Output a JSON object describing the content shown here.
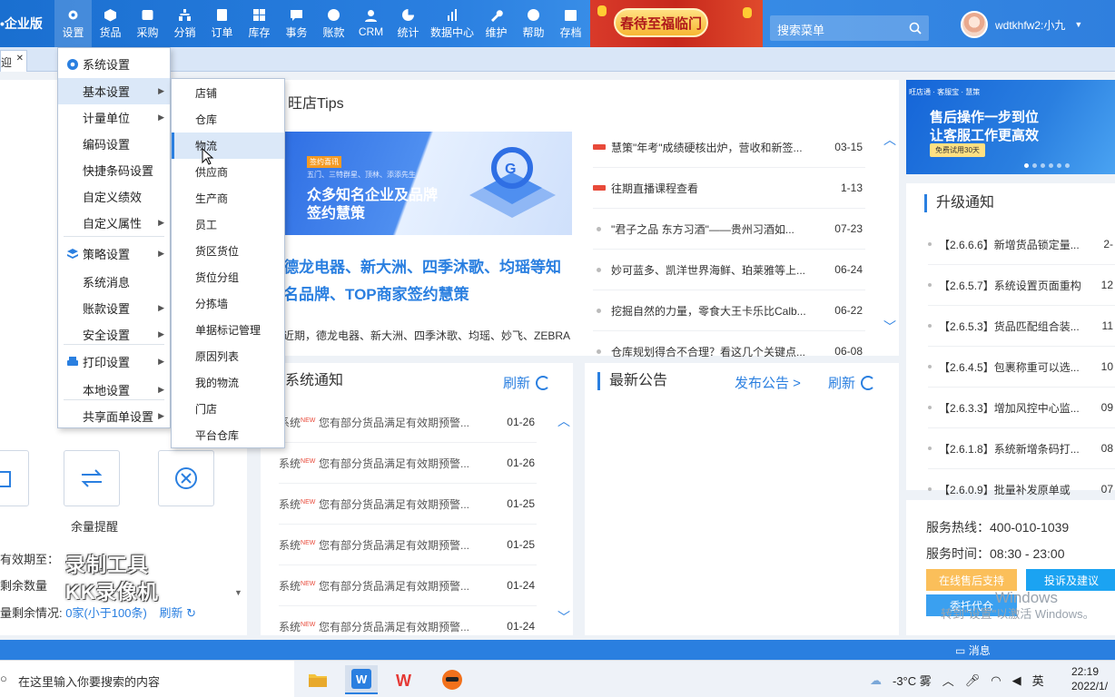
{
  "app": {
    "logo": "•企业版"
  },
  "nav": [
    {
      "label": "设置",
      "icon": "gear-icon"
    },
    {
      "label": "货品",
      "icon": "box-icon"
    },
    {
      "label": "采购",
      "icon": "cart-icon"
    },
    {
      "label": "分销",
      "icon": "distribution-icon"
    },
    {
      "label": "订单",
      "icon": "order-icon"
    },
    {
      "label": "库存",
      "icon": "grid-icon"
    },
    {
      "label": "事务",
      "icon": "chat-icon"
    },
    {
      "label": "账款",
      "icon": "yen-icon"
    },
    {
      "label": "CRM",
      "icon": "person-icon"
    },
    {
      "label": "统计",
      "icon": "pie-icon"
    },
    {
      "label": "数据中心",
      "icon": "bar-chart-icon"
    },
    {
      "label": "维护",
      "icon": "wrench-icon"
    },
    {
      "label": "帮助",
      "icon": "help-icon"
    },
    {
      "label": "存档",
      "icon": "archive-icon"
    }
  ],
  "festive_banner": "春待至福临门",
  "search": {
    "placeholder": "搜索菜单"
  },
  "user": {
    "name": "wdtkhfw2:小九"
  },
  "tab": {
    "label": "迎"
  },
  "settings_menu": [
    {
      "label": "系统设置",
      "group": true
    },
    {
      "label": "基本设置",
      "sub": true
    },
    {
      "label": "计量单位",
      "sub": true
    },
    {
      "label": "编码设置",
      "sub": false
    },
    {
      "label": "快捷条码设置",
      "sub": false
    },
    {
      "label": "自定义绩效",
      "sub": false
    },
    {
      "label": "自定义属性",
      "sub": true
    },
    {
      "label": "策略设置",
      "group": true,
      "sub": true
    },
    {
      "label": "系统消息",
      "sub": false
    },
    {
      "label": "账款设置",
      "sub": true
    },
    {
      "label": "安全设置",
      "sub": true
    },
    {
      "label": "打印设置",
      "group": true,
      "sub": true
    },
    {
      "label": "本地设置",
      "sub": true
    },
    {
      "label": "共享面单设置",
      "sub": true
    }
  ],
  "basic_submenu": [
    "店铺",
    "仓库",
    "物流",
    "供应商",
    "生产商",
    "员工",
    "货区货位",
    "货位分组",
    "分拣墙",
    "单据标记管理",
    "原因列表",
    "我的物流",
    "门店",
    "平台仓库"
  ],
  "tips": {
    "title": "旺店Tips",
    "banner": {
      "tag": "签约喜讯",
      "sub": "五门、三特群星、顶林、添添先生",
      "line1": "众多知名企业及品牌",
      "line2": "签约慧策"
    },
    "headline": "德龙电器、新大洲、四季沐歌、均瑶等知名品牌、TOP商家签约慧策",
    "desc": "近期，德龙电器、新大洲、四季沐歌、均瑶、妙飞、ZEBRA",
    "news": [
      {
        "text": "慧策\"年考\"成绩硬核出炉，营收和新签...",
        "date": "03-15",
        "hot": true
      },
      {
        "text": "往期直播课程查看",
        "date": "1-13",
        "hot": true
      },
      {
        "text": "\"君子之品 东方习酒\"——贵州习酒如...",
        "date": "07-23",
        "hot": false
      },
      {
        "text": "妙可蓝多、凯洋世界海鲜、珀莱雅等上...",
        "date": "06-24",
        "hot": false
      },
      {
        "text": "挖掘自然的力量，零食大王卡乐比Calb...",
        "date": "06-22",
        "hot": false
      },
      {
        "text": "仓库规划得合不合理？看这几个关键点...",
        "date": "06-08",
        "hot": false
      }
    ]
  },
  "sys_notice": {
    "title": "系统通知",
    "refresh": "刷新",
    "rows": [
      {
        "kind": "系统",
        "text": "您有部分货品满足有效期预警...",
        "date": "01-26"
      },
      {
        "kind": "系统",
        "text": "您有部分货品满足有效期预警...",
        "date": "01-26"
      },
      {
        "kind": "系统",
        "text": "您有部分货品满足有效期预警...",
        "date": "01-25"
      },
      {
        "kind": "系统",
        "text": "您有部分货品满足有效期预警...",
        "date": "01-25"
      },
      {
        "kind": "系统",
        "text": "您有部分货品满足有效期预警...",
        "date": "01-24"
      },
      {
        "kind": "系统",
        "text": "您有部分货品满足有效期预警...",
        "date": "01-24"
      }
    ]
  },
  "announcement": {
    "title": "最新公告",
    "publish": "发布公告 >",
    "refresh": "刷新"
  },
  "right_ad": {
    "brand": "旺店通 · 客服宝 · 慧策",
    "line1": "售后操作一步到位",
    "line2": "让客服工作更高效",
    "cta": "免费试用30天"
  },
  "upgrade": {
    "title": "升级通知",
    "rows": [
      {
        "text": "【2.6.6.6】新增货品锁定量...",
        "date": "2-"
      },
      {
        "text": "【2.6.5.7】系统设置页面重构",
        "date": "12"
      },
      {
        "text": "【2.6.5.3】货品匹配组合装...",
        "date": "11"
      },
      {
        "text": "【2.6.4.5】包裹称重可以选...",
        "date": "10"
      },
      {
        "text": "【2.6.3.3】增加风控中心监...",
        "date": "09"
      },
      {
        "text": "【2.6.1.8】系统新增条码打...",
        "date": "08"
      },
      {
        "text": "【2.6.0.9】批量补发原单或",
        "date": "07"
      }
    ]
  },
  "service": {
    "hotline": "服务热线：400-010-1039",
    "hours": "服务时间：08:30 - 23:00",
    "btn_online": "在线售后支持",
    "btn_complaint": "投诉及建议",
    "btn_entrust": "委托代仓"
  },
  "left_panel": {
    "yuliang": "余量提醒",
    "exp_label": "有效期至：",
    "remain_label": "剩余数量",
    "store_label": "量剩余情况:",
    "store_value": "0家(小于100条)",
    "refresh": "刷新",
    "watermark1": "录制工具",
    "watermark2": "KK录像机"
  },
  "windows_wm": {
    "line1": "Windows",
    "line2": "转到\"设置\"以激活 Windows。"
  },
  "statusbar": {
    "msg": "消息"
  },
  "taskbar": {
    "search": "在这里输入你要搜索的内容",
    "weather": "-3°C 雾",
    "ime": "英",
    "time": "22:19",
    "date": "2022/1/"
  }
}
